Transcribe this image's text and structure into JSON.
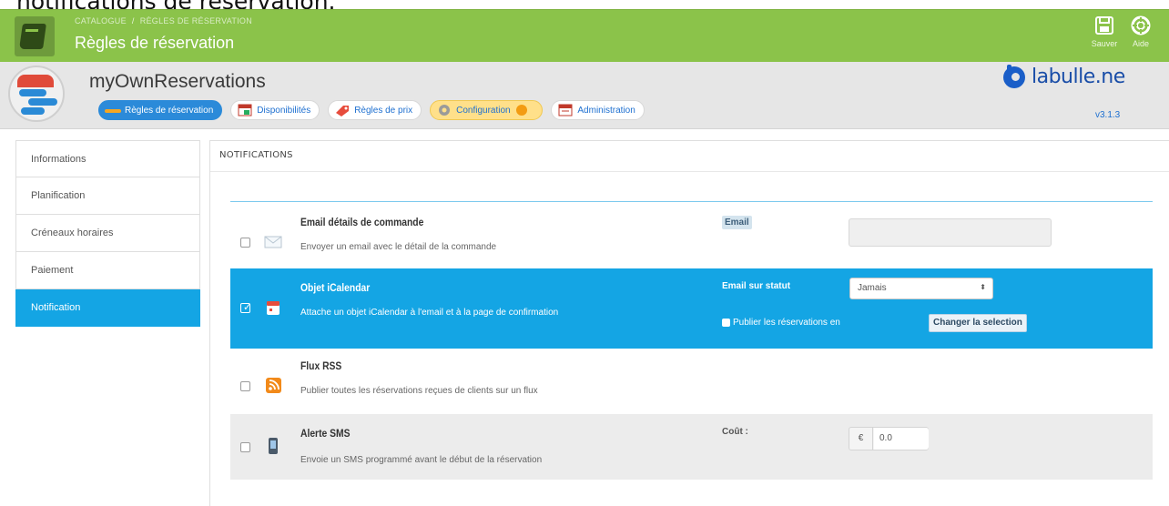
{
  "caption": "notifications de réservation.",
  "topbar": {
    "breadcrumb": [
      "CATALOGUE",
      "RÈGLES DE RÉSERVATION"
    ],
    "breadcrumb_sep": "/",
    "title": "Règles de réservation",
    "buttons": [
      {
        "label": "Sauver",
        "icon": "save-icon"
      },
      {
        "label": "Aide",
        "icon": "help-icon"
      }
    ]
  },
  "module": {
    "name": "myOwnReservations",
    "brand": "labulle.ne",
    "version": "v3.1.3",
    "tabs": [
      {
        "label": "Règles de réservation",
        "icon": "truck-icon",
        "active": true
      },
      {
        "label": "Disponibilités",
        "icon": "calendar-icon",
        "active": false
      },
      {
        "label": "Règles de prix",
        "icon": "tag-icon",
        "active": false
      },
      {
        "label": "Configuration",
        "icon": "gear-icon",
        "active": false
      },
      {
        "label": "Administration",
        "icon": "calendar-admin-icon",
        "active": false
      }
    ]
  },
  "sidebar": {
    "items": [
      {
        "label": "Informations",
        "active": false
      },
      {
        "label": "Planification",
        "active": false
      },
      {
        "label": "Créneaux horaires",
        "active": false
      },
      {
        "label": "Paiement",
        "active": false
      },
      {
        "label": "Notification",
        "active": true
      }
    ]
  },
  "panel": {
    "title": "NOTIFICATIONS",
    "rows": [
      {
        "title": "Email détails de commande",
        "desc": "Envoyer un email avec le détail de la commande",
        "icon": "envelope-icon",
        "checked": false,
        "field_label": "Email",
        "field_value": ""
      },
      {
        "title": "Objet iCalendar",
        "desc": "Attache un objet iCalendar à l'email et à la page de confirmation",
        "icon": "calendar-icon",
        "checked": true,
        "field_label": "Email sur statut",
        "select_value": "Jamais",
        "publish_label": "Publier les réservations en",
        "change_button": "Changer la selection"
      },
      {
        "title": "Flux RSS",
        "desc": "Publier toutes les réservations reçues de clients sur un flux",
        "icon": "rss-icon",
        "checked": false
      },
      {
        "title": "Alerte SMS",
        "desc": "Envoie un SMS programmé avant le début de la réservation",
        "icon": "phone-icon",
        "checked": false,
        "field_label": "Coût :",
        "currency": "€",
        "cost_value": "0.0"
      }
    ]
  },
  "colors": {
    "header_green": "#8bc34a",
    "accent_blue": "#14a5e4",
    "tab_blue": "#2b8ad9",
    "brand_blue": "#1a5ec8"
  }
}
